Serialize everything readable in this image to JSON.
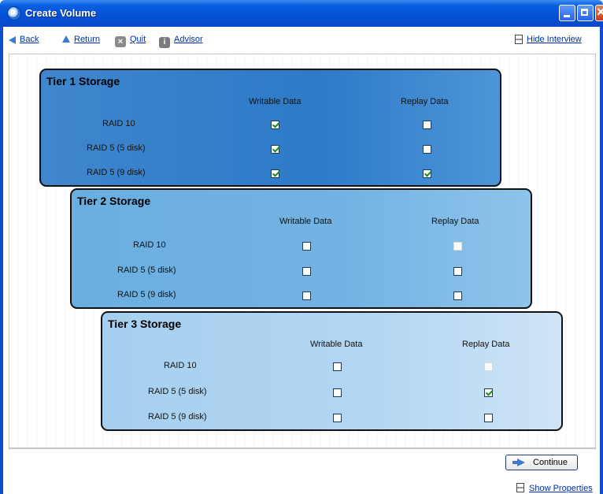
{
  "window": {
    "title": "Create Volume"
  },
  "toolbar": {
    "back": "Back",
    "return": "Return",
    "quit": "Quit",
    "advisor": "Advisor",
    "hide_interview": "Hide Interview"
  },
  "columns": {
    "writable": "Writable Data",
    "replay": "Replay Data"
  },
  "tiers": [
    {
      "title": "Tier 1 Storage",
      "rows": [
        {
          "label": "RAID 10",
          "writable": true,
          "replay": false,
          "replay_disabled": false
        },
        {
          "label": "RAID 5 (5 disk)",
          "writable": true,
          "replay": false,
          "replay_disabled": false
        },
        {
          "label": "RAID 5 (9 disk)",
          "writable": true,
          "replay": true,
          "replay_disabled": false
        }
      ]
    },
    {
      "title": "Tier 2 Storage",
      "rows": [
        {
          "label": "RAID 10",
          "writable": false,
          "replay": false,
          "replay_disabled": true
        },
        {
          "label": "RAID 5 (5 disk)",
          "writable": false,
          "replay": false,
          "replay_disabled": false
        },
        {
          "label": "RAID 5 (9 disk)",
          "writable": false,
          "replay": false,
          "replay_disabled": false
        }
      ]
    },
    {
      "title": "Tier 3 Storage",
      "rows": [
        {
          "label": "RAID 10",
          "writable": false,
          "replay": false,
          "replay_disabled": true
        },
        {
          "label": "RAID 5 (5 disk)",
          "writable": false,
          "replay": true,
          "replay_disabled": false
        },
        {
          "label": "RAID 5 (9 disk)",
          "writable": false,
          "replay": false,
          "replay_disabled": false
        }
      ]
    }
  ],
  "footer": {
    "continue": "Continue",
    "show_properties": "Show Properties"
  }
}
